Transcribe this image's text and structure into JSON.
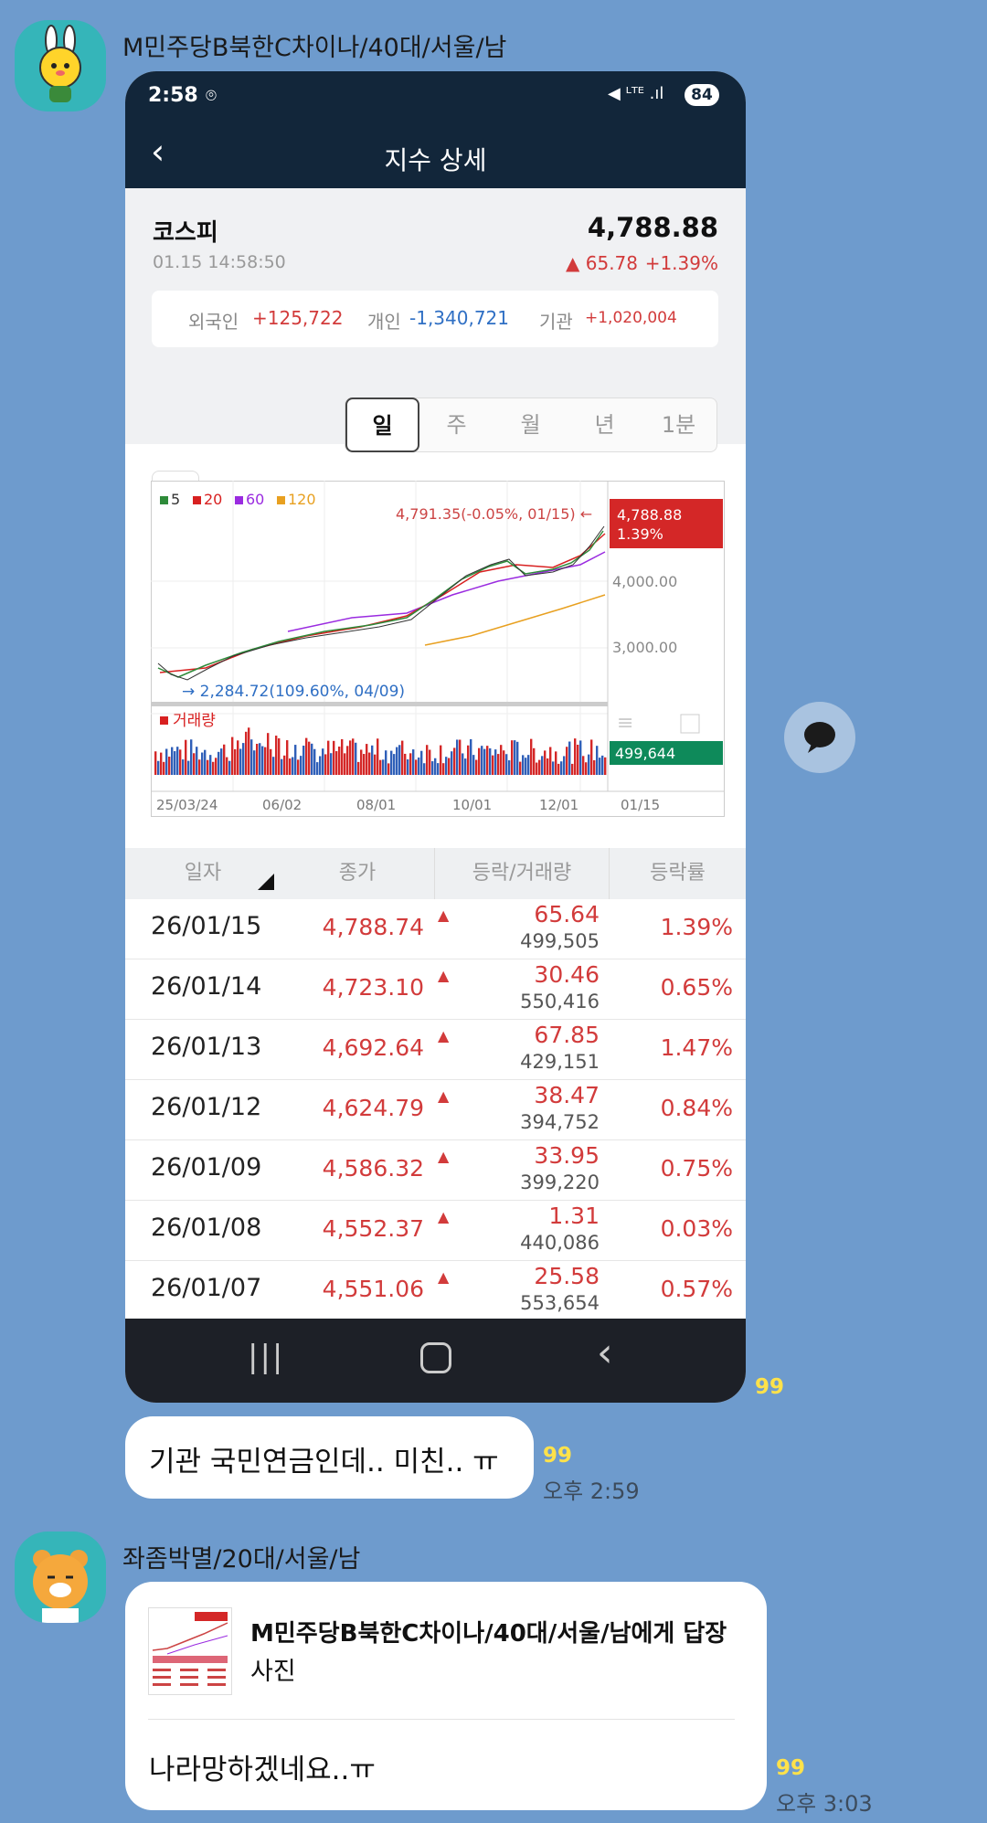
{
  "messages": [
    {
      "sender": "M민주당B북한C차이나/40대/서울/남",
      "unread": "99"
    },
    {
      "text": "기관 국민연금인데.. 미친.. ㅠ",
      "unread": "99",
      "time": "오후 2:59"
    },
    {
      "sender": "좌좀박멸/20대/서울/남",
      "reply_to": "M민주당B북한C차이나/40대/서울/남에게 답장",
      "reply_type": "사진",
      "text": "나라망하겠네요..ㅠ",
      "unread": "99",
      "time": "오후 3:03"
    }
  ],
  "screenshot": {
    "status_time": "2:58",
    "battery": "84",
    "header_title": "지수 상세",
    "index_name": "코스피",
    "index_value": "4,788.88",
    "timestamp": "01.15 14:58:50",
    "change": "▲ 65.78",
    "change_pct": "+1.39%",
    "investors": [
      {
        "label": "외국인",
        "value": "+125,722",
        "color": "#d23b3b"
      },
      {
        "label": "개인",
        "value": "-1,340,721",
        "color": "#2f6fc4"
      },
      {
        "label": "기관",
        "value": "+1,020,004",
        "color": "#d23b3b"
      }
    ],
    "period_tabs": [
      "일",
      "주",
      "월",
      "년",
      "1분"
    ],
    "active_tab": "일",
    "chart": {
      "legend": [
        {
          "label": "5",
          "color": "#2e8b3a"
        },
        {
          "label": "20",
          "color": "#d82020"
        },
        {
          "label": "60",
          "color": "#9a2be0"
        },
        {
          "label": "120",
          "color": "#e8a020"
        }
      ],
      "high_note": "4,791.35(-0.05%, 01/15) ←",
      "low_note": "→ 2,284.72(109.60%, 04/09)",
      "price_tag": "4,788.88",
      "price_tag_pct": "1.39%",
      "y_ticks": [
        "4,000.00",
        "3,000.00"
      ],
      "volume_label": "거래량",
      "volume_tag": "499,644",
      "x_ticks": [
        "25/03/24",
        "06/02",
        "08/01",
        "10/01",
        "12/01",
        "01/15"
      ]
    },
    "table_headers": [
      "일자",
      "종가",
      "등락/거래량",
      "등락률"
    ],
    "rows": [
      {
        "date": "26/01/15",
        "close": "4,788.74",
        "chg": "65.64",
        "vol": "499,505",
        "rate": "1.39%"
      },
      {
        "date": "26/01/14",
        "close": "4,723.10",
        "chg": "30.46",
        "vol": "550,416",
        "rate": "0.65%"
      },
      {
        "date": "26/01/13",
        "close": "4,692.64",
        "chg": "67.85",
        "vol": "429,151",
        "rate": "1.47%"
      },
      {
        "date": "26/01/12",
        "close": "4,624.79",
        "chg": "38.47",
        "vol": "394,752",
        "rate": "0.84%"
      },
      {
        "date": "26/01/09",
        "close": "4,586.32",
        "chg": "33.95",
        "vol": "399,220",
        "rate": "0.75%"
      },
      {
        "date": "26/01/08",
        "close": "4,552.37",
        "chg": "1.31",
        "vol": "440,086",
        "rate": "0.03%"
      },
      {
        "date": "26/01/07",
        "close": "4,551.06",
        "chg": "25.58",
        "vol": "553,654",
        "rate": "0.57%"
      }
    ]
  },
  "colors": {
    "chat_bg": "#6e9bcd",
    "up": "#d23b3b",
    "down": "#2f6fc4",
    "unread": "#ffe24a"
  }
}
